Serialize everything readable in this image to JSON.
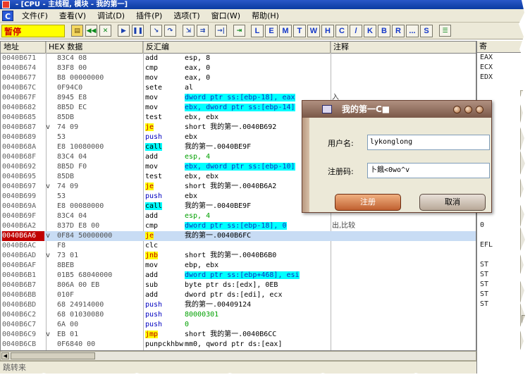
{
  "window": {
    "title": "- [CPU - 主线程, 模块 - 我的第一]"
  },
  "menu": {
    "icon_letter": "C",
    "items": [
      "文件(F)",
      "查看(V)",
      "调试(D)",
      "插件(P)",
      "选项(T)",
      "窗口(W)",
      "帮助(H)"
    ]
  },
  "toolbar": {
    "status": "暂停",
    "letters": [
      "L",
      "E",
      "M",
      "T",
      "W",
      "H",
      "C",
      "/",
      "K",
      "B",
      "R",
      "...",
      "S"
    ]
  },
  "columns": {
    "addr": "地址",
    "hex": "HEX 数据",
    "disasm": "反汇编",
    "comment": "注释"
  },
  "rows": [
    {
      "addr": "0040B671",
      "arrow": "",
      "hex": "83C4 08",
      "mn": "add",
      "op": "esp, 8",
      "cm": "",
      "mt": "",
      "ot": ""
    },
    {
      "addr": "0040B674",
      "arrow": "",
      "hex": "83F8 00",
      "mn": "cmp",
      "op": "eax, 0",
      "cm": "",
      "mt": "",
      "ot": ""
    },
    {
      "addr": "0040B677",
      "arrow": "",
      "hex": "B8 00000000",
      "mn": "mov",
      "op": "eax, 0",
      "cm": "",
      "mt": "",
      "ot": ""
    },
    {
      "addr": "0040B67C",
      "arrow": "",
      "hex": "0F94C0",
      "mn": "sete",
      "op": "al",
      "cm": "",
      "mt": "",
      "ot": ""
    },
    {
      "addr": "0040B67F",
      "arrow": "",
      "hex": "8945 E8",
      "mn": "mov",
      "op": "dword ptr ss:[ebp-18], eax",
      "cm": "入",
      "mt": "",
      "ot": "mem"
    },
    {
      "addr": "0040B682",
      "arrow": "",
      "hex": "8B5D EC",
      "mn": "mov",
      "op": "ebx, dword ptr ss:[ebp-14]",
      "cm": "",
      "mt": "",
      "ot": "mem"
    },
    {
      "addr": "0040B685",
      "arrow": "",
      "hex": "85DB",
      "mn": "test",
      "op": "ebx, ebx",
      "cm": "",
      "mt": "",
      "ot": ""
    },
    {
      "addr": "0040B687",
      "arrow": "v",
      "hex": "74 09",
      "mn": "je",
      "op": "short 我的第一.0040B692",
      "cm": "",
      "mt": "jmp",
      "ot": ""
    },
    {
      "addr": "0040B689",
      "arrow": "",
      "hex": "53",
      "mn": "push",
      "op": "ebx",
      "cm": "",
      "mt": "push",
      "ot": ""
    },
    {
      "addr": "0040B68A",
      "arrow": "",
      "hex": "E8 10080000",
      "mn": "call",
      "op": "我的第一.0040BE9F",
      "cm": "",
      "mt": "call",
      "ot": ""
    },
    {
      "addr": "0040B68F",
      "arrow": "",
      "hex": "83C4 04",
      "mn": "add",
      "op": "esp, 4",
      "cm": "",
      "mt": "",
      "ot": "num"
    },
    {
      "addr": "0040B692",
      "arrow": "",
      "hex": "8B5D F0",
      "mn": "mov",
      "op": "ebx, dword ptr ss:[ebp-10]",
      "cm": "",
      "mt": "",
      "ot": "mem"
    },
    {
      "addr": "0040B695",
      "arrow": "",
      "hex": "85DB",
      "mn": "test",
      "op": "ebx, ebx",
      "cm": "",
      "mt": "",
      "ot": ""
    },
    {
      "addr": "0040B697",
      "arrow": "v",
      "hex": "74 09",
      "mn": "je",
      "op": "short 我的第一.0040B6A2",
      "cm": "",
      "mt": "jmp",
      "ot": ""
    },
    {
      "addr": "0040B699",
      "arrow": "",
      "hex": "53",
      "mn": "push",
      "op": "ebx",
      "cm": "",
      "mt": "push",
      "ot": ""
    },
    {
      "addr": "0040B69A",
      "arrow": "",
      "hex": "E8 00080000",
      "mn": "call",
      "op": "我的第一.0040BE9F",
      "cm": "",
      "mt": "call",
      "ot": ""
    },
    {
      "addr": "0040B69F",
      "arrow": "",
      "hex": "83C4 04",
      "mn": "add",
      "op": "esp, 4",
      "cm": "",
      "mt": "",
      "ot": "num"
    },
    {
      "addr": "0040B6A2",
      "arrow": "",
      "hex": "837D E8 00",
      "mn": "cmp",
      "op": "dword ptr ss:[ebp-18], 0",
      "cm": "出,比较",
      "mt": "",
      "ot": "mem"
    },
    {
      "addr": "0040B6A6",
      "arrow": "v",
      "hex": "0F84 50000000",
      "mn": "je",
      "op": "我的第一.0040B6FC",
      "cm": "",
      "mt": "jmp",
      "ot": "",
      "sel": true
    },
    {
      "addr": "0040B6AC",
      "arrow": "",
      "hex": "F8",
      "mn": "clc",
      "op": "",
      "cm": "",
      "mt": "",
      "ot": ""
    },
    {
      "addr": "0040B6AD",
      "arrow": "v",
      "hex": "73 01",
      "mn": "jnb",
      "op": "short 我的第一.0040B6B0",
      "cm": "",
      "mt": "jmp",
      "ot": ""
    },
    {
      "addr": "0040B6AF",
      "arrow": "",
      "hex": "8BEB",
      "mn": "mov",
      "op": "ebp, ebx",
      "cm": "",
      "mt": "",
      "ot": ""
    },
    {
      "addr": "0040B6B1",
      "arrow": "",
      "hex": "01B5 68040000",
      "mn": "add",
      "op": "dword ptr ss:[ebp+468], esi",
      "cm": "",
      "mt": "",
      "ot": "mem"
    },
    {
      "addr": "0040B6B7",
      "arrow": "",
      "hex": "806A 00 EB",
      "mn": "sub",
      "op": "byte ptr ds:[edx], 0EB",
      "cm": "",
      "mt": "",
      "ot": ""
    },
    {
      "addr": "0040B6BB",
      "arrow": "",
      "hex": "010F",
      "mn": "add",
      "op": "dword ptr ds:[edi], ecx",
      "cm": "",
      "mt": "",
      "ot": ""
    },
    {
      "addr": "0040B6BD",
      "arrow": "",
      "hex": "68 24914000",
      "mn": "push",
      "op": "我的第一.00409124",
      "cm": "",
      "mt": "push",
      "ot": ""
    },
    {
      "addr": "0040B6C2",
      "arrow": "",
      "hex": "68 01030080",
      "mn": "push",
      "op": "80000301",
      "cm": "",
      "mt": "push",
      "ot": "num"
    },
    {
      "addr": "0040B6C7",
      "arrow": "",
      "hex": "6A 00",
      "mn": "push",
      "op": "0",
      "cm": "",
      "mt": "push",
      "ot": "num"
    },
    {
      "addr": "0040B6C9",
      "arrow": "v",
      "hex": "EB 01",
      "mn": "jmp",
      "op": "short 我的第一.0040B6CC",
      "cm": "",
      "mt": "jmp",
      "ot": ""
    },
    {
      "addr": "0040B6CB",
      "arrow": "",
      "hex": "0F6840 00",
      "mn": "punpckhbw",
      "op": "mm0, qword ptr ds:[eax]",
      "cm": "",
      "mt": "",
      "ot": ""
    }
  ],
  "registers": [
    "EAX",
    "ECX",
    "EDX",
    "",
    "",
    "",
    "",
    "",
    "",
    "",
    "",
    "",
    "",
    "",
    "DS",
    "",
    "",
    "0",
    "",
    "EFL",
    "",
    "ST",
    "ST",
    "ST",
    "ST",
    "ST"
  ],
  "status": {
    "text": "跳转来"
  },
  "dialog": {
    "title": "我的第一C■",
    "username_label": "用户名:",
    "username_value": "lykonglong",
    "serial_label": "注册码:",
    "serial_value": "卜餓<0wo^v",
    "register_button": "注册",
    "cancel_button": "取消"
  },
  "colors": {
    "jump": "#ffff00",
    "call": "#00ffff",
    "selected_row": "#c8dcf4",
    "paused": "#ffff00"
  }
}
